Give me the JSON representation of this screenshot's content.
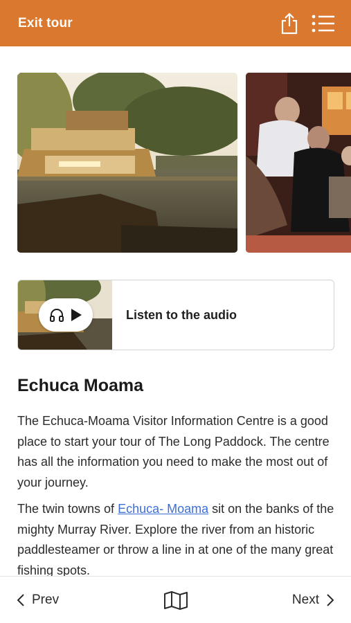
{
  "header": {
    "exit_label": "Exit tour",
    "share_icon": "share-icon",
    "menu_icon": "list-menu-icon",
    "background_color": "#d9782e"
  },
  "gallery": {
    "photos": [
      {
        "name": "paddlesteamer-photo"
      },
      {
        "name": "diners-photo"
      }
    ]
  },
  "audio": {
    "label": "Listen to the audio",
    "icons": [
      "headphones-icon",
      "play-icon"
    ]
  },
  "main": {
    "title": "Echuca Moama",
    "paragraph1": "The Echuca-Moama Visitor Information Centre is a good place to start your tour of The Long Paddock. The centre has all the information you need to make the most out of your journey.",
    "paragraph2_before": "The twin towns of ",
    "paragraph2_link": "Echuca- Moama",
    "paragraph2_after": " sit on the banks of the mighty Murray River. Explore the river from an historic paddlesteamer or throw a line in at one of the many great fishing spots.",
    "link_color": "#3b6fd8"
  },
  "footer": {
    "prev_label": "Prev",
    "next_label": "Next",
    "map_icon": "map-icon"
  }
}
